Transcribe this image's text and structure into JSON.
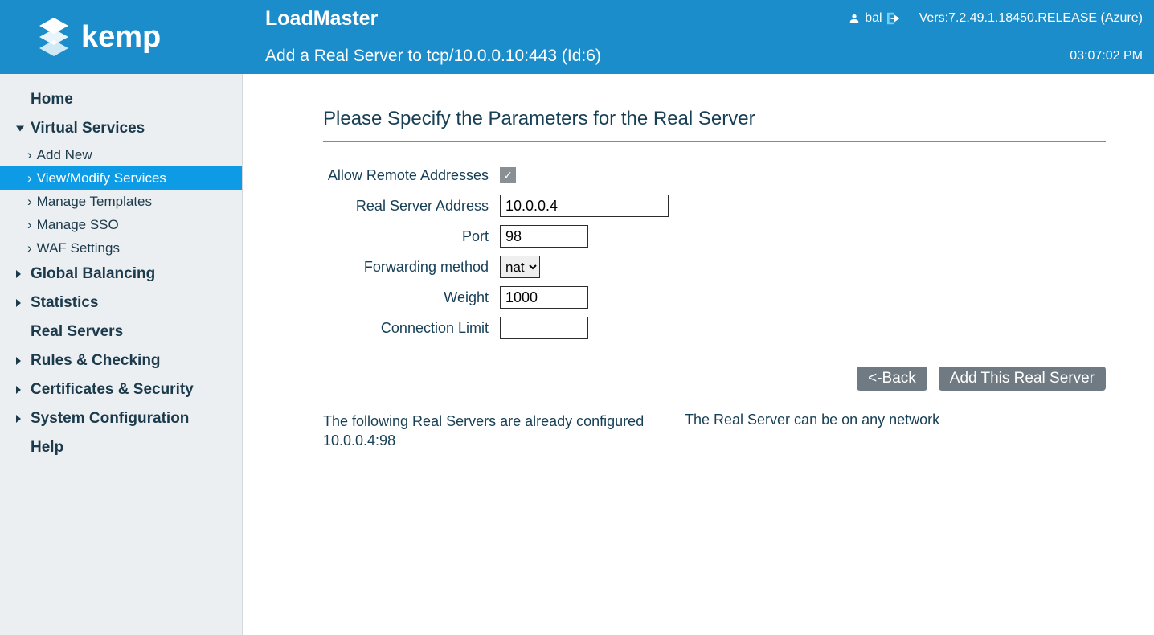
{
  "header": {
    "product": "LoadMaster",
    "user": "bal",
    "version": "Vers:7.2.49.1.18450.RELEASE (Azure)",
    "subtitle": "Add a Real Server to tcp/10.0.0.10:443 (Id:6)",
    "clock": "03:07:02 PM"
  },
  "sidebar": {
    "home": "Home",
    "virtual_services": "Virtual Services",
    "vs_add_new": "Add New",
    "vs_view_modify": "View/Modify Services",
    "vs_manage_templates": "Manage Templates",
    "vs_manage_sso": "Manage SSO",
    "vs_waf": "WAF Settings",
    "global_balancing": "Global Balancing",
    "statistics": "Statistics",
    "real_servers": "Real Servers",
    "rules": "Rules & Checking",
    "certs": "Certificates & Security",
    "sysconf": "System Configuration",
    "help": "Help"
  },
  "form": {
    "title": "Please Specify the Parameters for the Real Server",
    "allow_remote_label": "Allow Remote Addresses",
    "allow_remote_checked": true,
    "rsaddr_label": "Real Server Address",
    "rsaddr_value": "10.0.0.4",
    "port_label": "Port",
    "port_value": "98",
    "fwd_label": "Forwarding method",
    "fwd_value": "nat",
    "weight_label": "Weight",
    "weight_value": "1000",
    "connlimit_label": "Connection Limit",
    "connlimit_value": ""
  },
  "buttons": {
    "back": "<-Back",
    "add": "Add This Real Server"
  },
  "footer": {
    "already_line": "The following Real Servers are already configured",
    "already_value": "10.0.0.4:98",
    "any_network": "The Real Server can be on any network"
  }
}
